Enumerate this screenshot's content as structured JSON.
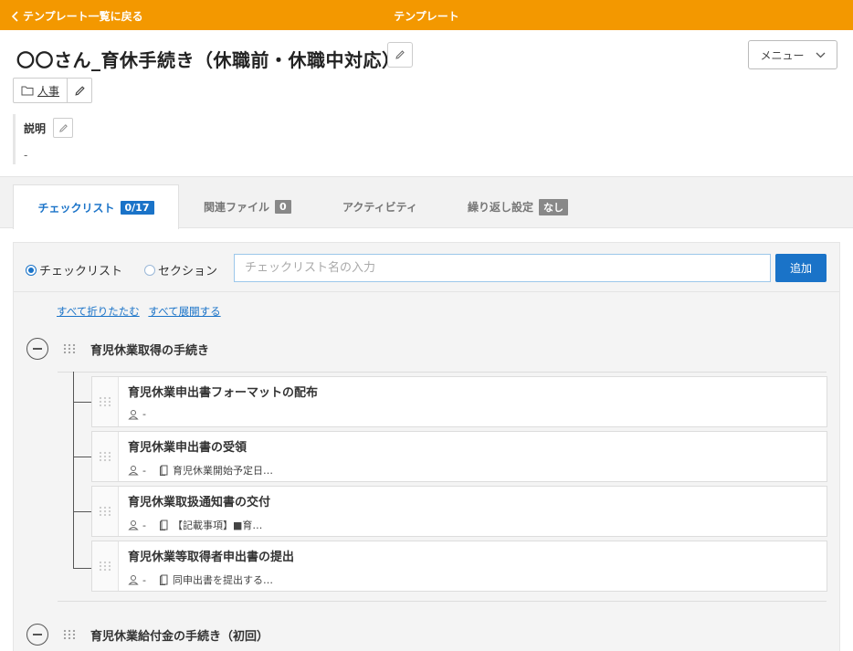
{
  "topbar": {
    "back_label": "テンプレート一覧に戻る",
    "title": "テンプレート"
  },
  "template": {
    "title": "〇〇さん_育休手続き（休職前・休職中対応）"
  },
  "menu": {
    "label": "メニュー"
  },
  "category": {
    "label": "人事"
  },
  "description": {
    "label": "説明",
    "value": "-"
  },
  "tabs": [
    {
      "label": "チェックリスト",
      "badge": "0/17"
    },
    {
      "label": "関連ファイル",
      "badge": "0"
    },
    {
      "label": "アクティビティ"
    },
    {
      "label": "繰り返し設定",
      "badge": "なし"
    }
  ],
  "add_form": {
    "radio_checklist": "チェックリスト",
    "radio_section": "セクション",
    "input_placeholder": "チェックリスト名の入力",
    "add_label": "追加"
  },
  "links": {
    "collapse_all": "すべて折りたたむ",
    "expand_all": "すべて展開する"
  },
  "sections": [
    {
      "title": "育児休業取得の手続き",
      "items": [
        {
          "name": "育児休業申出書フォーマットの配布",
          "assignee": "-",
          "note": ""
        },
        {
          "name": "育児休業申出書の受領",
          "assignee": "-",
          "note": "育児休業開始予定日…"
        },
        {
          "name": "育児休業取扱通知書の交付",
          "assignee": "-",
          "note": "【記載事項】■育…"
        },
        {
          "name": "育児休業等取得者申出書の提出",
          "assignee": "-",
          "note": "同申出書を提出する…"
        }
      ]
    },
    {
      "title": "育児休業給付金の手続き（初回）",
      "items": []
    }
  ],
  "colors": {
    "accent_orange": "#f39800",
    "primary_blue": "#1a73c8"
  }
}
